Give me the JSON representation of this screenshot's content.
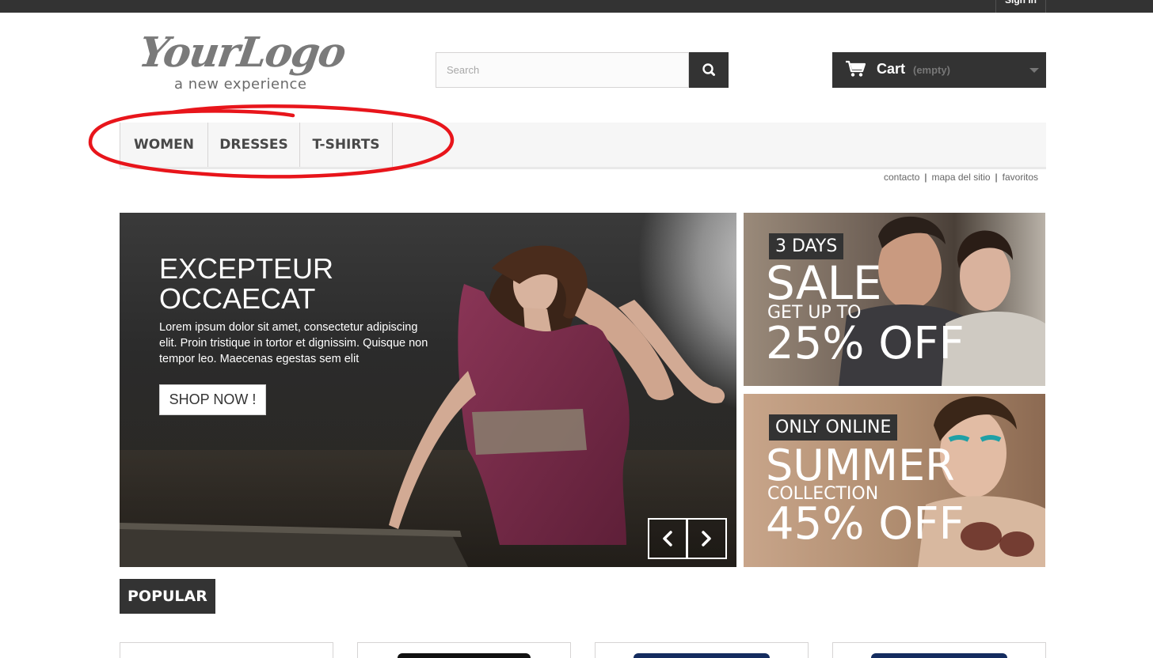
{
  "header": {
    "signin_label": "Sign in",
    "logo": {
      "main": "YourLogo",
      "tagline": "a new experience"
    },
    "search": {
      "placeholder": "Search",
      "button_icon": "search-icon"
    },
    "cart": {
      "label": "Cart",
      "status": "(empty)",
      "icon": "cart-icon"
    }
  },
  "menu": {
    "items": [
      {
        "label": "WOMEN"
      },
      {
        "label": "DRESSES"
      },
      {
        "label": "T-SHIRTS"
      }
    ]
  },
  "sublinks": [
    "contacto",
    "mapa del sitio",
    "favoritos"
  ],
  "slider": {
    "title": "EXCEPTEUR OCCAECAT",
    "text": "Lorem ipsum dolor sit amet, consectetur adipiscing elit. Proin tristique in tortor et dignissim. Quisque non tempor leo. Maecenas egestas sem elit",
    "button": "SHOP NOW !"
  },
  "banners": [
    {
      "tag": "3 DAYS",
      "line1": "SALE",
      "line2": "GET UP TO",
      "line3": "25% OFF"
    },
    {
      "tag": "ONLY ONLINE",
      "line1": "SUMMER",
      "line2": "COLLECTION",
      "line3": "45% OFF"
    }
  ],
  "sections": {
    "popular": "POPULAR"
  },
  "colors": {
    "dark": "#333333",
    "menu_bg": "#f6f6f6",
    "annotation": "#e8151b",
    "slide_dress": "#7b2b4a"
  }
}
